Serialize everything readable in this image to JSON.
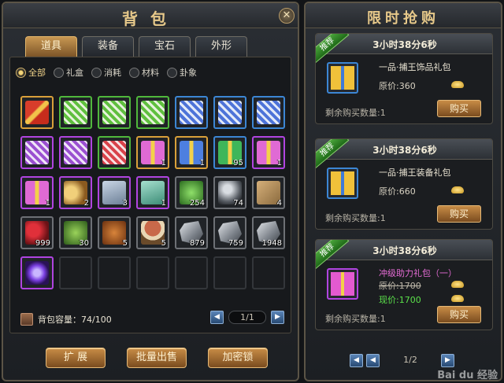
{
  "bag": {
    "title": "背包",
    "close_label": "✕",
    "tabs": [
      "道具",
      "装备",
      "宝石",
      "外形"
    ],
    "active_tab": 0,
    "filters": [
      "全部",
      "礼盒",
      "消耗",
      "材料",
      "卦象"
    ],
    "active_filter": 0,
    "items": [
      {
        "icon": "red-gift-box-icon",
        "style": "i-giftred",
        "quality": "gold",
        "count": ""
      },
      {
        "icon": "green-heart-gift-icon",
        "style": "i-heartgreen",
        "quality": "green",
        "count": ""
      },
      {
        "icon": "green-heart-gift-icon",
        "style": "i-heartgreen",
        "quality": "green",
        "count": ""
      },
      {
        "icon": "green-heart-gift-icon",
        "style": "i-heartgreen",
        "quality": "green",
        "count": ""
      },
      {
        "icon": "blue-heart-gift-icon",
        "style": "i-heartblue",
        "quality": "blue",
        "count": ""
      },
      {
        "icon": "blue-heart-gift-icon",
        "style": "i-heartblue",
        "quality": "blue",
        "count": ""
      },
      {
        "icon": "blue-heart-gift-icon",
        "style": "i-heartblue",
        "quality": "blue",
        "count": ""
      },
      {
        "icon": "purple-heart-gift-icon",
        "style": "i-heartpurple",
        "quality": "purple",
        "count": ""
      },
      {
        "icon": "purple-heart-gift-icon",
        "style": "i-heartpurple",
        "quality": "purple",
        "count": ""
      },
      {
        "icon": "red-heart-gift-icon",
        "style": "i-heartred",
        "quality": "green",
        "count": ""
      },
      {
        "icon": "pink-gift-box-icon",
        "style": "i-giftpink",
        "quality": "gold",
        "count": "1"
      },
      {
        "icon": "blue-gift-box-icon",
        "style": "i-giftblue",
        "quality": "gold",
        "count": "1"
      },
      {
        "icon": "green-gift-box-icon",
        "style": "i-giftgreen",
        "quality": "blue",
        "count": "95"
      },
      {
        "icon": "pink-gift-box-icon",
        "style": "i-giftpink",
        "quality": "purple",
        "count": "1"
      },
      {
        "icon": "pink-gift-box-icon",
        "style": "i-giftpink",
        "quality": "purple",
        "count": "1"
      },
      {
        "icon": "horn-icon",
        "style": "i-horn",
        "quality": "purple",
        "count": "2"
      },
      {
        "icon": "tag-icon",
        "style": "i-tag",
        "quality": "purple",
        "count": "3"
      },
      {
        "icon": "teal-tag-icon",
        "style": "i-tagteal",
        "quality": "purple",
        "count": "1"
      },
      {
        "icon": "exp-orb-icon",
        "style": "i-exp",
        "quality": "grey",
        "count": "254"
      },
      {
        "icon": "crystal-ball-icon",
        "style": "i-ball",
        "quality": "grey",
        "count": "74"
      },
      {
        "icon": "sealed-letter-icon",
        "style": "i-letter",
        "quality": "grey",
        "count": "4"
      },
      {
        "icon": "red-berry-icon",
        "style": "i-berry",
        "quality": "grey",
        "count": "999"
      },
      {
        "icon": "herb-icon",
        "style": "i-herb",
        "quality": "grey",
        "count": "30"
      },
      {
        "icon": "nut-icon",
        "style": "i-nut",
        "quality": "grey",
        "count": "5"
      },
      {
        "icon": "mushroom-icon",
        "style": "i-mush",
        "quality": "grey",
        "count": "5"
      },
      {
        "icon": "silver-ore-icon",
        "style": "i-ore",
        "quality": "grey",
        "count": "879"
      },
      {
        "icon": "silver-ore-icon",
        "style": "i-ore",
        "quality": "grey",
        "count": "759"
      },
      {
        "icon": "silver-ore-icon",
        "style": "i-ore",
        "quality": "grey",
        "count": "1948"
      },
      {
        "icon": "hammer-rune-icon",
        "style": "i-hammer",
        "quality": "purple",
        "count": ""
      }
    ],
    "empty_slots": 6,
    "capacity_label": "背包容量：74/100",
    "page": "1/1",
    "prev_icon": "◀",
    "next_icon": "▶",
    "actions": [
      "扩 展",
      "批量出售",
      "加密锁"
    ]
  },
  "shop": {
    "title": "限时抢购",
    "offers": [
      {
        "timer": "3小时38分6秒",
        "badge": "推荐",
        "name": "一品·捕王饰品礼包",
        "icon": "blue-gift-box-icon",
        "price_label": "原价:360",
        "sale_label": "",
        "remain": "剩余购买数量:1",
        "buy": "购买"
      },
      {
        "timer": "3小时38分6秒",
        "badge": "推荐",
        "name": "一品·捕王装备礼包",
        "icon": "blue-gift-box-icon",
        "price_label": "原价:660",
        "sale_label": "",
        "remain": "剩余购买数量:1",
        "buy": "购买"
      },
      {
        "timer": "3小时38分6秒",
        "badge": "推荐",
        "name": "冲级助力礼包（一）",
        "icon": "pink-gift-box-icon",
        "price_label": "原价:1700",
        "sale_label": "现价:1700",
        "remain": "剩余购买数量:1",
        "buy": "购买"
      }
    ],
    "page": "1/2",
    "first_icon": "◀",
    "prev_icon": "◀",
    "next_icon": "▶"
  },
  "watermark": "Bai du 经验"
}
